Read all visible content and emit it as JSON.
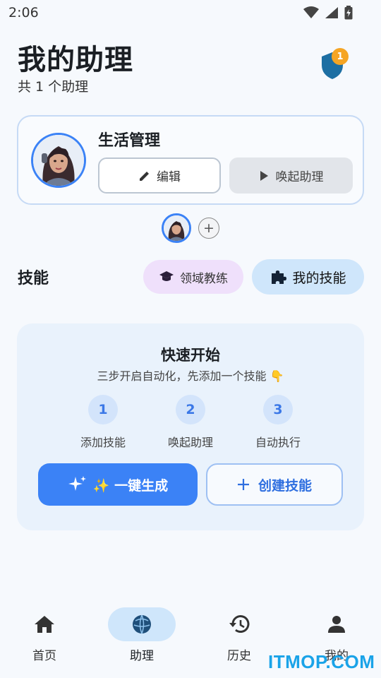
{
  "status_bar": {
    "time": "2:06"
  },
  "header": {
    "title": "我的助理",
    "subtitle": "共 1 个助理",
    "shield_badge": "1"
  },
  "assistant_card": {
    "name": "生活管理",
    "edit_label": "编辑",
    "wake_label": "唤起助理"
  },
  "add_assistant_symbol": "+",
  "skills": {
    "label": "技能",
    "coach_chip": "领域教练",
    "my_skills_chip": "我的技能"
  },
  "quick_start": {
    "title": "快速开始",
    "desc": "三步开启自动化，先添加一个技能 👇",
    "steps": [
      {
        "num": "1",
        "label": "添加技能"
      },
      {
        "num": "2",
        "label": "唤起助理"
      },
      {
        "num": "3",
        "label": "自动执行"
      }
    ],
    "generate_label": "✨ 一键生成",
    "create_label": "创建技能"
  },
  "bottom_nav": {
    "items": [
      {
        "label": "首页",
        "icon": "home-icon"
      },
      {
        "label": "助理",
        "icon": "assistant-globe-icon",
        "active": true
      },
      {
        "label": "历史",
        "icon": "history-icon"
      },
      {
        "label": "我的",
        "icon": "person-icon"
      }
    ]
  },
  "watermark": "ITMOP.COM",
  "colors": {
    "accent": "#3b82f6",
    "badge": "#f5a524",
    "shield": "#1d6fa3",
    "coach_chip_bg": "#efe0fb",
    "skills_chip_bg": "#cfe6fb"
  }
}
